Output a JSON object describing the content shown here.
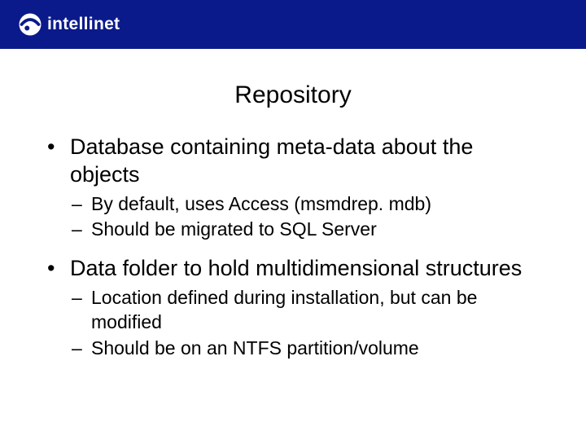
{
  "brand": {
    "name": "intellinet"
  },
  "slide": {
    "title": "Repository",
    "bullets": [
      {
        "text": "Database containing meta-data about the objects",
        "sub": [
          "By default, uses Access (msmdrep. mdb)",
          "Should be migrated to SQL Server"
        ]
      },
      {
        "text": "Data folder to hold multidimensional structures",
        "sub": [
          "Location defined during installation, but can be modified",
          "Should be on an NTFS partition/volume"
        ]
      }
    ]
  }
}
